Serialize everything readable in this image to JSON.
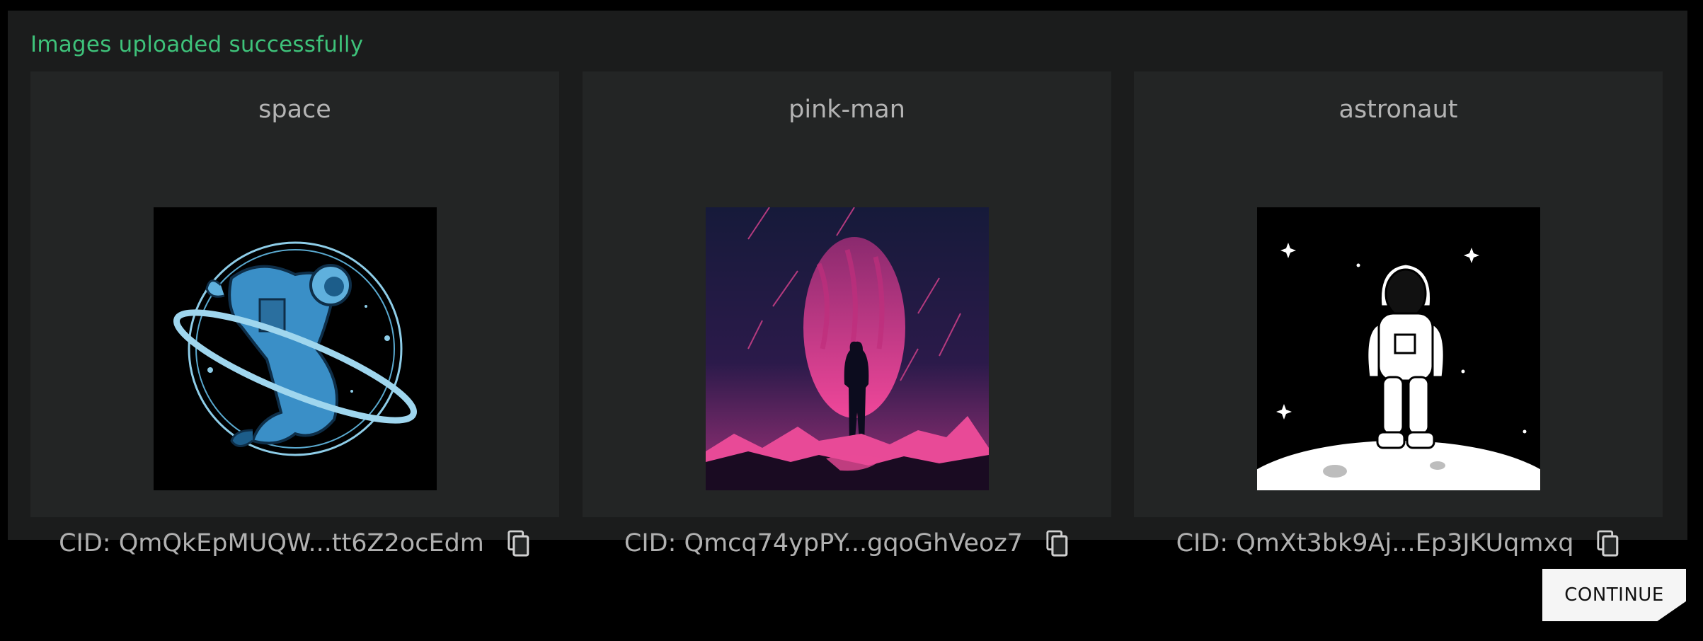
{
  "status_message": "Images uploaded successfully",
  "colors": {
    "success": "#3ec27a",
    "panel_bg": "#1b1c1c",
    "card_bg": "#232525",
    "button_bg": "#f5f5f5"
  },
  "cards": [
    {
      "title": "space",
      "cid": "CID: QmQkEpMUQW...tt6Z2ocEdm",
      "image": "blue-astronaut-orbit"
    },
    {
      "title": "pink-man",
      "cid": "CID: Qmcq74ypPY...gqoGhVeoz7",
      "image": "figure-before-pink-planet"
    },
    {
      "title": "astronaut",
      "cid": "CID: QmXt3bk9Aj...Ep3JKUqmxq",
      "image": "white-astronaut-on-moon"
    }
  ],
  "icons": {
    "copy": "copy-icon"
  },
  "continue_label": "CONTINUE"
}
